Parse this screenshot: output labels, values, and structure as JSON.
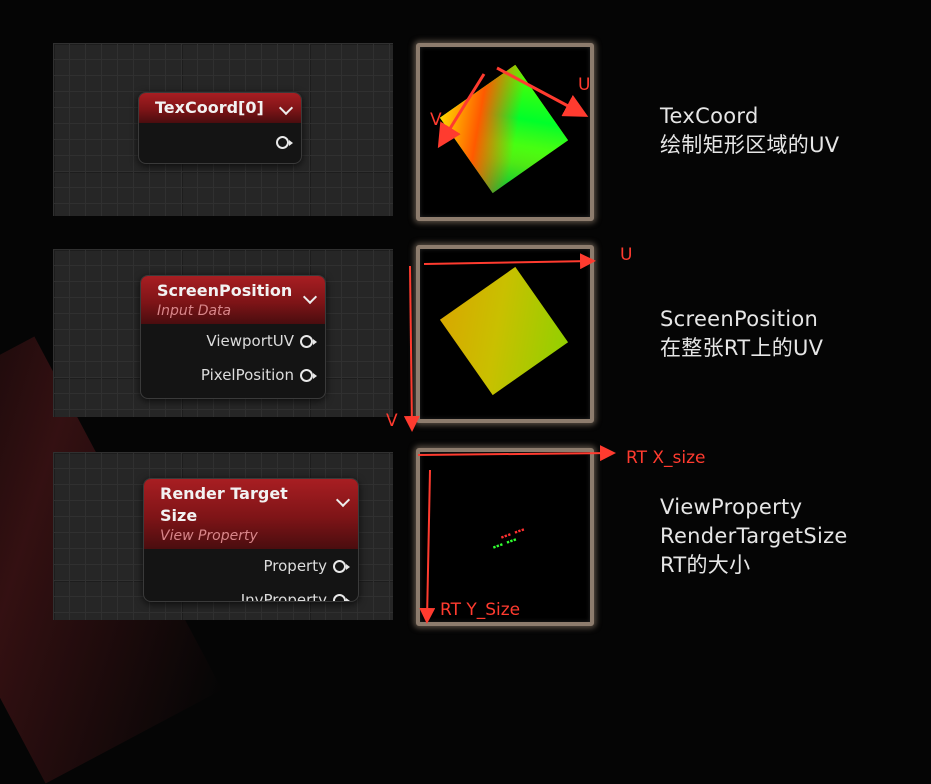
{
  "rows": [
    {
      "node": {
        "title": "TexCoord[0]",
        "subtitle": "",
        "pins": [
          ""
        ]
      },
      "description": [
        "TexCoord",
        "绘制矩形区域的UV"
      ],
      "axis_labels": {
        "u": "U",
        "v": "V"
      }
    },
    {
      "node": {
        "title": "ScreenPosition",
        "subtitle": "Input Data",
        "pins": [
          "ViewportUV",
          "PixelPosition"
        ]
      },
      "description": [
        "ScreenPosition",
        "在整张RT上的UV"
      ],
      "axis_labels": {
        "u": "U",
        "v": "V"
      }
    },
    {
      "node": {
        "title": "Render Target Size",
        "subtitle": "View Property",
        "pins": [
          "Property",
          "InvProperty"
        ]
      },
      "description": [
        "ViewProperty",
        "RenderTargetSize",
        "RT的大小"
      ],
      "axis_labels": {
        "u": "RT X_size",
        "v": "RT Y_Size"
      }
    }
  ],
  "colors": {
    "annotation": "#ff3b2f",
    "node_header": "#a81e22",
    "preview_border": "#8d7c6d"
  }
}
